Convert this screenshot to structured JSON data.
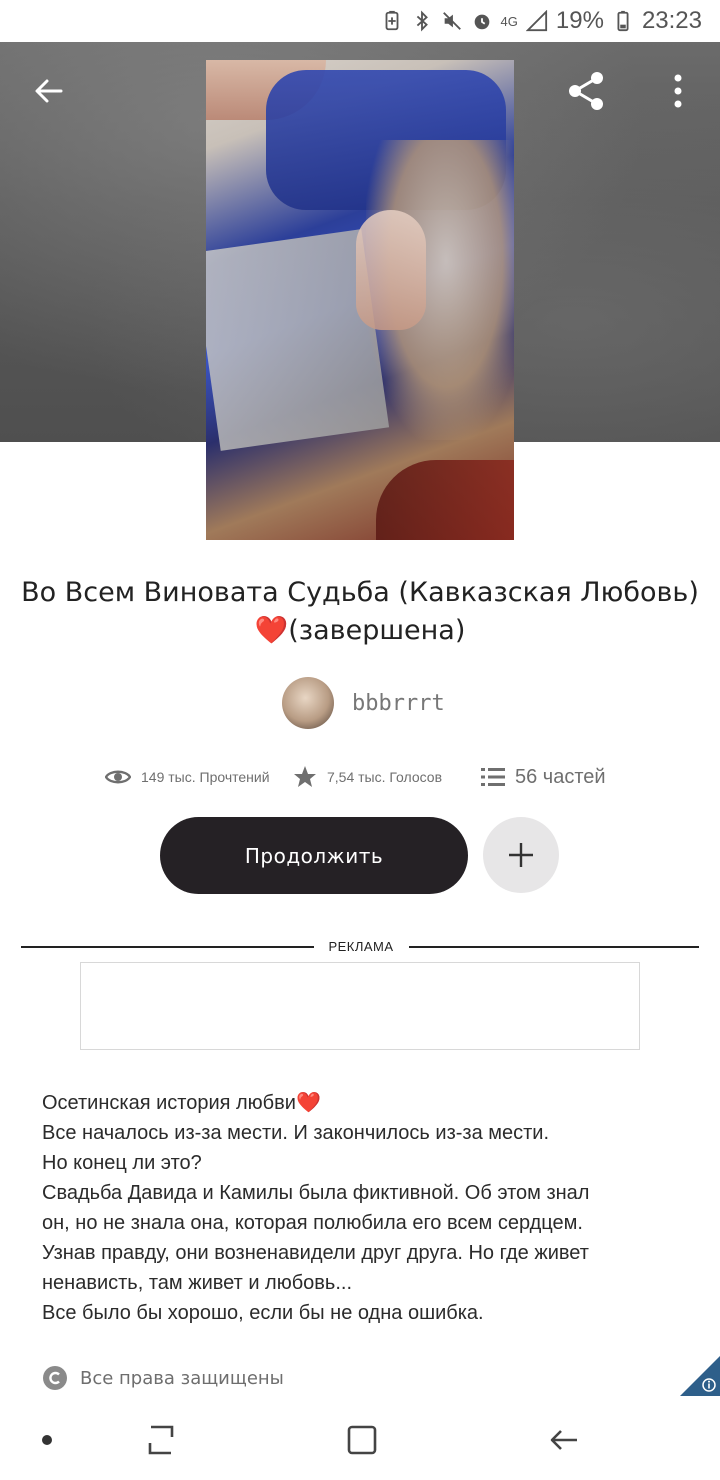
{
  "status_bar": {
    "battery_percent": "19%",
    "time": "23:23",
    "network": "4G",
    "icons": [
      "battery-saver-icon",
      "bluetooth-icon",
      "mute-icon",
      "alarm-icon",
      "signal-icon",
      "battery-icon"
    ]
  },
  "header": {
    "back_icon": "arrow-left-icon",
    "share_icon": "share-icon",
    "more_icon": "more-vertical-icon"
  },
  "story": {
    "title": "Во Всем Виновата Судьба (Кавказская Любовь)",
    "title_heart": "❤️",
    "title_suffix": "(завершена)",
    "author": "bbbrrrt"
  },
  "stats": {
    "reads": "149 тыс. Прочтений",
    "votes": "7,54 тыс. Голосов",
    "parts": "56 частей"
  },
  "actions": {
    "continue_label": "Продолжить",
    "add_icon": "plus-icon"
  },
  "ad": {
    "label": "РЕКЛАМА"
  },
  "description": {
    "lines": [
      "Осетинская история любви",
      "Все началось из-за мести. И закончилось из-за мести.",
      "Но конец ли это?",
      "Свадьба Давида и Камилы была фиктивной. Об этом знал",
      "он, но не знала она, которая полюбила его всем сердцем.",
      "Узнав правду, они возненавидели друг друга. Но где живет",
      "ненависть, там живет и любовь...",
      "Все было бы хорошо, если бы не одна ошибка."
    ],
    "heart": "❤️"
  },
  "copyright": {
    "label": "Все права защищены",
    "icon": "copyright-icon"
  },
  "nav": {
    "icons": [
      "dot-icon",
      "recent-apps-icon",
      "home-icon",
      "back-icon"
    ]
  },
  "colors": {
    "continue_bg": "#252125",
    "add_bg": "#e7e6e7",
    "heart": "#e0282b",
    "badge": "#2e5f8a"
  }
}
